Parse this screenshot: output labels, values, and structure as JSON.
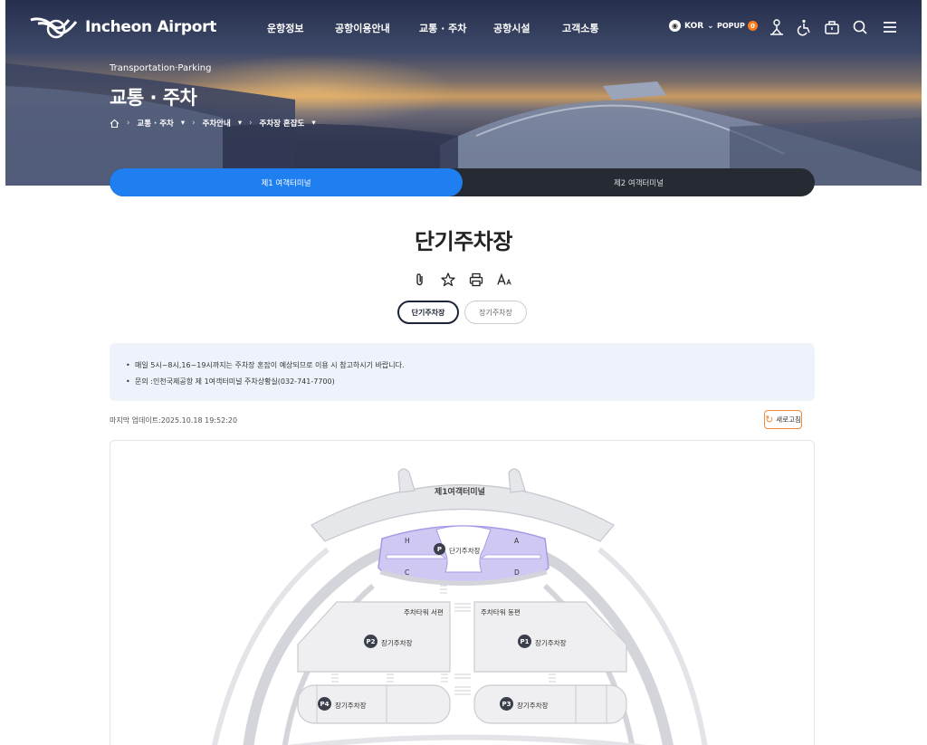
{
  "brand": {
    "name": "Incheon Airport"
  },
  "gnb": [
    "운항정보",
    "공항이용안내",
    "교통 · 주차",
    "공항시설",
    "고객소통"
  ],
  "util": {
    "lang": "KOR",
    "popup_label": "POPUP",
    "popup_count": "0"
  },
  "hero": {
    "subtitle": "Transportation·Parking",
    "title": "교통 · 주차",
    "breadcrumb": [
      "교통 · 주차",
      "주차안내",
      "주차장 혼잡도"
    ]
  },
  "terminal_tabs": [
    "제1 여객터미널",
    "제2 여객터미널"
  ],
  "page_title": "단기주차장",
  "sub_tabs": [
    "단기주차장",
    "장기주차장"
  ],
  "notice": [
    "매일 5시~8시,16~19시까지는 주차장 혼잡이 예상되므로 이용 시 참고하시기 바랍니다.",
    "문의 :인천국제공항 제 1여객터미널 주차상황실(032-741-7700)"
  ],
  "updated": "마지막 업데이트:2025.10.18 19:52:20",
  "refresh_label": "새로고침",
  "map": {
    "terminal_label": "제1여객터미널",
    "short_term_label": "단기주차장",
    "zones": {
      "h": "H",
      "a": "A",
      "c": "C",
      "d": "D"
    },
    "tower_west": "주차타워 서편",
    "tower_east": "주차타워 동편",
    "long_term_label": "장기주차장",
    "p_badges": {
      "p": "P",
      "p1": "P1",
      "p2": "P2",
      "p3": "P3",
      "p4": "P4"
    }
  }
}
